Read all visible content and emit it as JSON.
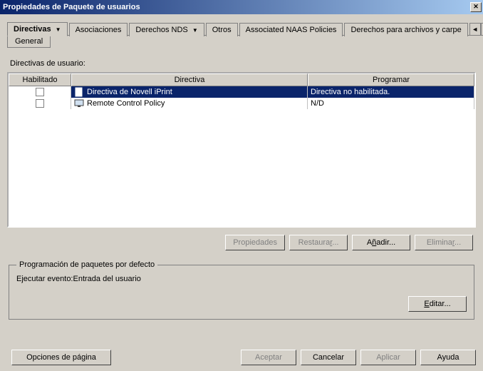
{
  "window": {
    "title": "Propiedades de Paquete de usuarios"
  },
  "tabs": {
    "directivas": "Directivas",
    "asociaciones": "Asociaciones",
    "derechos_nds": "Derechos NDS",
    "otros": "Otros",
    "naas": "Associated NAAS Policies",
    "archivos": "Derechos para archivos y carpe",
    "sub_general": "General"
  },
  "section": {
    "user_directives": "Directivas de usuario:"
  },
  "grid": {
    "headers": {
      "enabled": "Habilitado",
      "directive": "Directiva",
      "schedule": "Programar"
    },
    "rows": [
      {
        "enabled": false,
        "directive": "Directiva de Novell iPrint",
        "schedule": "Directiva no habilitada.",
        "selected": true,
        "icon": "doc-icon"
      },
      {
        "enabled": false,
        "directive": "Remote Control Policy",
        "schedule": "N/D",
        "selected": false,
        "icon": "monitor-icon"
      }
    ]
  },
  "buttons": {
    "properties": "Propiedades",
    "restore_pre": "Restaura",
    "restore_accel": "r",
    "restore_post": "...",
    "add_pre": "A",
    "add_accel": "ñ",
    "add_post": "adir...",
    "delete_pre": "Elimina",
    "delete_accel": "r",
    "delete_post": "...",
    "edit_pre": "",
    "edit_accel": "E",
    "edit_post": "ditar..."
  },
  "schedule_group": {
    "legend": "Programación de paquetes por defecto",
    "run_event_label": "Ejecutar evento:",
    "run_event_value": "Entrada del usuario"
  },
  "dialog_buttons": {
    "page_options": "Opciones de página",
    "ok": "Aceptar",
    "cancel": "Cancelar",
    "apply": "Aplicar",
    "help": "Ayuda"
  }
}
